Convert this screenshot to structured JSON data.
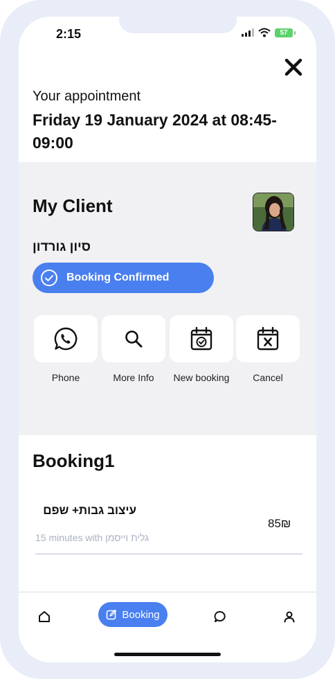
{
  "status": {
    "time": "2:15",
    "battery": "57"
  },
  "appointment": {
    "label": "Your appointment",
    "date": "Friday 19 January 2024 at 08:45-09:00"
  },
  "client": {
    "title": "My Client",
    "name": "סיון גורדון",
    "status_label": "Booking Confirmed",
    "actions": [
      {
        "label": "Phone",
        "icon": "whatsapp-icon"
      },
      {
        "label": "More Info",
        "icon": "search-icon"
      },
      {
        "label": "New booking",
        "icon": "calendar-check-icon"
      },
      {
        "label": "Cancel",
        "icon": "calendar-x-icon"
      }
    ]
  },
  "booking": {
    "title": "Booking1",
    "service": "עיצוב גבות+ שפם",
    "price": "85₪",
    "details": "15 minutes with גלית וייסמן"
  },
  "tabbar": {
    "booking_label": "Booking"
  },
  "colors": {
    "accent": "#4a7ff0",
    "section_bg": "#f1f1f4",
    "frame": "#e8edf8"
  }
}
